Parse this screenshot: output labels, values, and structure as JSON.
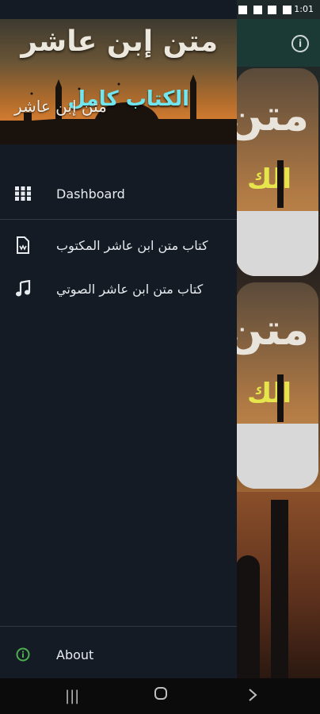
{
  "status_bar": {
    "left_icons": [
      "sim-icon",
      "signal-icon",
      "wifi-icon",
      "alarm-icon",
      "lock-icon"
    ],
    "right_icons": [
      "facebook-icon",
      "check-icon",
      "image-icon",
      "sim-icon"
    ],
    "time": "1:01"
  },
  "drawer": {
    "header": {
      "title": "متن إبن عاشر",
      "subtitle": "الكتاب كامل",
      "caption": "متن إبن عاشر"
    },
    "items": [
      {
        "label": "Dashboard",
        "icon": "grid-icon"
      },
      {
        "label": "كتاب متن ابن عاشر المكتوب",
        "icon": "document-icon"
      },
      {
        "label": "كتاب متن ابن عاشر الصوتي",
        "icon": "music-note-icon"
      }
    ],
    "footer_item": {
      "label": "About",
      "icon": "info-icon"
    }
  },
  "background_app": {
    "card_title": "متن",
    "card_subtitle": "الك",
    "info_icon": "info-icon"
  },
  "colors": {
    "drawer_bg": "#151b24",
    "divider": "#2e3946",
    "text": "#e7ebef",
    "accent_info": "#4caf50",
    "subtitle_color": "#6fe6f0"
  }
}
